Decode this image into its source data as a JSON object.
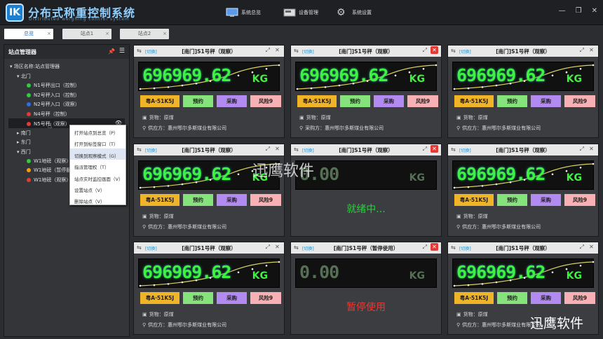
{
  "app": {
    "logo_text": "IK",
    "title": "分布式称重控制系统",
    "subtitle": "Distributed weighing control system"
  },
  "nav": [
    {
      "label": "系统总览",
      "icon": "monitor-icon"
    },
    {
      "label": "设备管理",
      "icon": "device-icon"
    },
    {
      "label": "系统设置",
      "icon": "gear-icon"
    }
  ],
  "window": {
    "minimize": "—",
    "restore": "❐",
    "close": "✕"
  },
  "tabs": [
    {
      "label": "总览",
      "active": true
    },
    {
      "label": "站点1",
      "active": false
    },
    {
      "label": "站点2",
      "active": false
    }
  ],
  "sidebar": {
    "title": "站点管理器",
    "root": "场区名称:站点管理器",
    "groups": [
      {
        "name": "北门",
        "items": [
          {
            "label": "N1号秤出口（控制）",
            "color": "#2ecc40"
          },
          {
            "label": "N2号秤入口（控制）",
            "color": "#2ecc40"
          },
          {
            "label": "N2号秤入口（观察）",
            "color": "#2e6fe8"
          },
          {
            "label": "N4号秤（控制）",
            "color": "#e53935"
          },
          {
            "label": "N5号秤（观察）",
            "color": "#e53935"
          }
        ]
      },
      {
        "name": "南门",
        "items": []
      },
      {
        "name": "东门",
        "items": []
      },
      {
        "name": "西门",
        "items": [
          {
            "label": "W1地磅（观察）",
            "color": "#2ecc40"
          },
          {
            "label": "W1地磅（暂停服",
            "color": "#f39c12"
          },
          {
            "label": "W1地磅（观察）",
            "color": "#e53935"
          }
        ]
      }
    ]
  },
  "context_menu": [
    "打开站点到总览（P）",
    "打开到标签窗口（T）",
    "切换到观察模式（G）",
    "指派管理权（T）",
    "站点实时监控画面（V）",
    "设置站点（V）",
    "删除站点（V）"
  ],
  "cards": [
    {
      "switch": "[切换]",
      "title": "[南门]S1号秤（观察）",
      "weight": "696969.62",
      "unit": "KG",
      "plate": "粤A·51K5J",
      "b2": "预约",
      "b3": "采购",
      "b4": "风险9",
      "goods_label": "货物：",
      "goods": "原煤",
      "party_label": "供应方：",
      "party": "惠州鄂尔多斯煤业有限公司",
      "state": "normal",
      "red_close": false
    },
    {
      "switch": "[切换]",
      "title": "[南门]S1号秤（观察）",
      "weight": "696969.62",
      "unit": "KG",
      "plate": "粤A·51K5J",
      "b2": "预约",
      "b3": "采购",
      "b4": "风险9",
      "goods_label": "货物：",
      "goods": "原煤",
      "party_label": "采购方：",
      "party": "惠州鄂尔多斯煤业有限公司",
      "state": "normal",
      "red_close": true
    },
    {
      "switch": "[切换]",
      "title": "[南门]S1号秤（观察）",
      "weight": "696969.62",
      "unit": "KG",
      "plate": "粤A·51K5J",
      "b2": "预约",
      "b3": "采购",
      "b4": "风险9",
      "goods_label": "货物：",
      "goods": "原煤",
      "party_label": "供应方：",
      "party": "惠州鄂尔多斯煤业有限公司",
      "state": "normal",
      "red_close": false
    },
    {
      "switch": "[切换]",
      "title": "[南门]S1号秤（观察）",
      "weight": "696969.62",
      "unit": "KG",
      "plate": "粤A·51K5J",
      "b2": "预约",
      "b3": "采购",
      "b4": "风险9",
      "goods_label": "货物：",
      "goods": "原煤",
      "party_label": "供应方：",
      "party": "惠州鄂尔多斯煤业有限公司",
      "state": "normal",
      "red_close": false
    },
    {
      "switch": "[切换]",
      "title": "[南门]S1号秤（观察）",
      "weight": "0.00",
      "unit": "KG",
      "message": "就绪中...",
      "message_color": "#2ecc40",
      "state": "message",
      "red_close": true
    },
    {
      "switch": "[切换]",
      "title": "[南门]S1号秤（观察）",
      "weight": "696969.62",
      "unit": "KG",
      "plate": "粤A·51K5J",
      "b2": "预约",
      "b3": "采购",
      "b4": "风险9",
      "goods_label": "货物：",
      "goods": "原煤",
      "party_label": "供应方：",
      "party": "惠州鄂尔多斯煤业有限公司",
      "state": "normal",
      "red_close": false
    },
    {
      "switch": "[切换]",
      "title": "[南门]S1号秤（观察）",
      "weight": "696969.62",
      "unit": "KG",
      "plate": "粤A·51K5J",
      "b2": "预约",
      "b3": "采购",
      "b4": "风险9",
      "goods_label": "货物：",
      "goods": "原煤",
      "party_label": "供应方：",
      "party": "惠州鄂尔多斯煤业有限公司",
      "state": "normal",
      "red_close": false
    },
    {
      "switch": "[切换]",
      "title": "[南门]S1号秤（暂停使用）",
      "weight": "0.00",
      "unit": "KG",
      "message": "暂停使用",
      "message_color": "#e53935",
      "state": "message",
      "red_close": true
    },
    {
      "switch": "[切换]",
      "title": "[南门]S1号秤（观察）",
      "weight": "696969.62",
      "unit": "KG",
      "plate": "粤A·51K5J",
      "b2": "预约",
      "b3": "采购",
      "b4": "风险9",
      "goods_label": "货物：",
      "goods": "原煤",
      "party_label": "供应方：",
      "party": "惠州鄂尔多斯煤业有限公司",
      "state": "normal",
      "red_close": false
    }
  ],
  "watermark": {
    "center": "迅鹰软件",
    "corner": "迅鹰软件"
  }
}
